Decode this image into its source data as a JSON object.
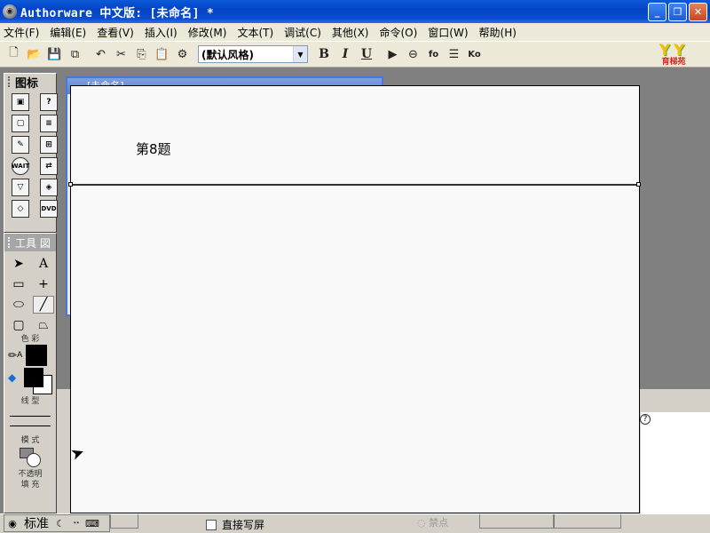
{
  "window": {
    "title": "Authorware 中文版: [未命名] *",
    "controls": [
      "minimize",
      "maximize",
      "close"
    ]
  },
  "menu": {
    "items": [
      "文件(F)",
      "编辑(E)",
      "查看(V)",
      "插入(I)",
      "修改(M)",
      "文本(T)",
      "调试(C)",
      "其他(X)",
      "命令(O)",
      "窗口(W)",
      "帮助(H)"
    ]
  },
  "toolbar": {
    "style_select": "(默认风格)",
    "bold": "B",
    "italic": "I",
    "underline": "U",
    "fo_label": "fo",
    "ko_label": "Ko",
    "logo_text": "YY",
    "logo_subtext": "育梯苑"
  },
  "icon_palette": {
    "title": "图标",
    "icons": [
      "display-icon",
      "interaction-icon",
      "calculation-icon",
      "decision-icon",
      "wait-icon",
      "erase-icon",
      "navigate-icon",
      "framework-icon",
      "movie-icon",
      "sound-icon",
      "map-icon",
      "dvd-icon"
    ],
    "wait_label": "WAIT",
    "dvd_label": "DVD"
  },
  "tools_palette": {
    "title": "工具 図",
    "color_label": "色 彩",
    "lines_label": "线 型",
    "mode_label": "模 式",
    "mode_value": "不透明",
    "fill_label": "填 充"
  },
  "design_window": {
    "title": "[未命名]"
  },
  "stage": {
    "title_text": "第8题"
  },
  "status": {
    "mode_text": "标准",
    "direct_write_label": "直接写屏",
    "anchor_label": "◌ 禁点"
  },
  "colors": {
    "titlebar": "#0a4cd0",
    "chrome": "#ece9d8",
    "palette": "#d4d0c8",
    "workspace": "#808080",
    "stage_bg": "#f9f9f9"
  }
}
